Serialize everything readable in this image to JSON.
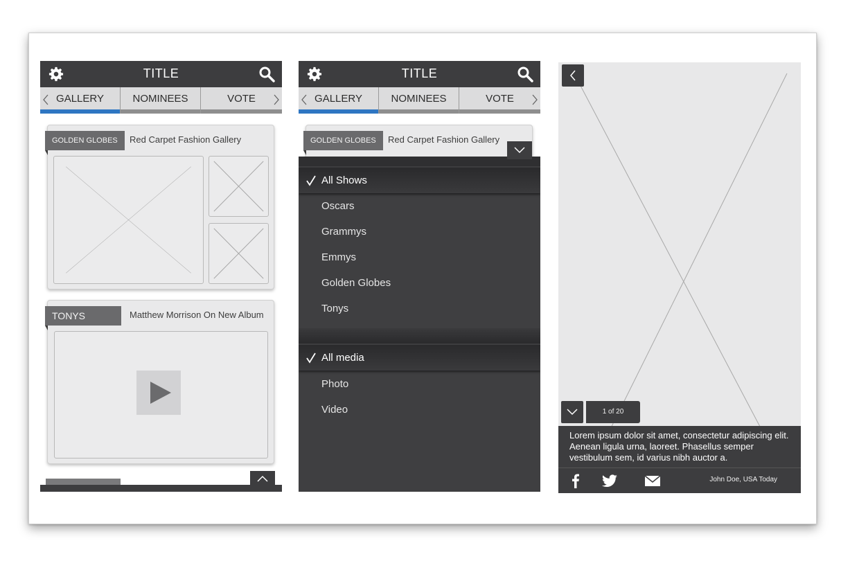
{
  "app": {
    "title": "TITLE",
    "tabs": [
      {
        "label": "GALLERY",
        "active": true
      },
      {
        "label": "NOMINEES",
        "active": false
      },
      {
        "label": "VOTE",
        "active": false
      }
    ]
  },
  "feed": {
    "cards": [
      {
        "category": "GOLDEN GLOBES",
        "title": "Red Carpet Fashion Gallery",
        "type": "gallery"
      },
      {
        "category": "TONYS",
        "title": "Matthew Morrison On New Album",
        "type": "video"
      }
    ]
  },
  "filter": {
    "card": {
      "category": "GOLDEN GLOBES",
      "title": "Red Carpet Fashion Gallery"
    },
    "shows": {
      "selected": "All Shows",
      "options": [
        "Oscars",
        "Grammys",
        "Emmys",
        "Golden Globes",
        "Tonys"
      ]
    },
    "media": {
      "selected": "All media",
      "options": [
        "Photo",
        "Video"
      ]
    }
  },
  "viewer": {
    "page_current": "1",
    "page_of": "of",
    "page_total": "20",
    "caption": "Lorem ipsum dolor sit amet, consectetur adipiscing elit. Aenean ligula urna, laoreet. Phasellus semper vestibulum sem, id varius nibh auctor a.",
    "credit": "John Doe, USA Today"
  },
  "icons": {
    "settings": "gear-icon",
    "search": "search-icon",
    "check": "checkmark-icon",
    "facebook": "facebook-icon",
    "twitter": "twitter-icon",
    "email": "email-icon"
  },
  "colors": {
    "bar": "#3d3d3f",
    "active_tab": "#2e76c2",
    "card_label": "#6a6a6c"
  }
}
